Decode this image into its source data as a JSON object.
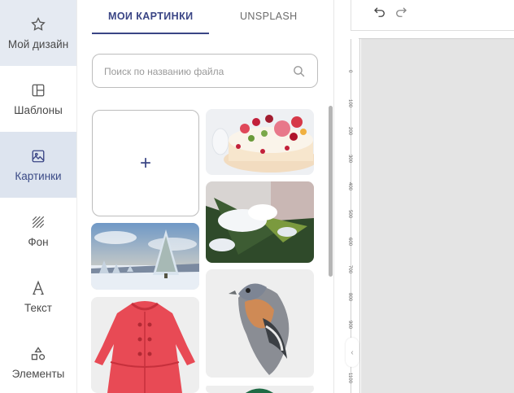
{
  "sidebar": {
    "items": [
      {
        "label": "Мой дизайн",
        "icon": "star-icon"
      },
      {
        "label": "Шаблоны",
        "icon": "template-icon"
      },
      {
        "label": "Картинки",
        "icon": "image-icon"
      },
      {
        "label": "Фон",
        "icon": "background-pattern-icon"
      },
      {
        "label": "Текст",
        "icon": "text-icon"
      },
      {
        "label": "Элементы",
        "icon": "shapes-icon"
      }
    ]
  },
  "panel": {
    "tabs": [
      {
        "label": "МОИ КАРТИНКИ",
        "active": true
      },
      {
        "label": "UNSPLASH",
        "active": false
      }
    ],
    "search": {
      "placeholder": "Поиск по названию файла",
      "value": ""
    },
    "upload_symbol": "+",
    "images": [
      {
        "name": "cake",
        "subject": "decorated cake with roses"
      },
      {
        "name": "snowy-pine-branch",
        "subject": "snow-covered fir branch"
      },
      {
        "name": "winter-landscape",
        "subject": "snowy trees under blue sky"
      },
      {
        "name": "red-coat",
        "subject": "red child's coat"
      },
      {
        "name": "bird",
        "subject": "chaffinch bird"
      },
      {
        "name": "green-item",
        "subject": "green object partially visible"
      }
    ]
  },
  "workspace": {
    "ruler_ticks": [
      "0",
      "100",
      "200",
      "300",
      "400",
      "500",
      "600",
      "700",
      "800",
      "900",
      "1000",
      "1100"
    ],
    "collapse_glyph": "‹"
  },
  "colors": {
    "accent": "#3a4585",
    "active_bg": "#e5eaf2",
    "canvas_bg": "#e4e4e4"
  }
}
